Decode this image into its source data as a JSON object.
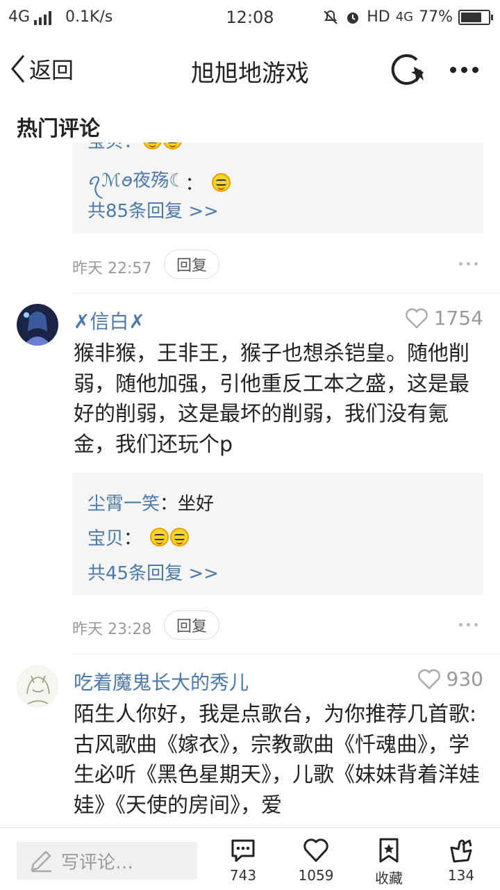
{
  "status_bar": {
    "network": "4G",
    "speed": "0.1K/s",
    "time": "12:08",
    "hd": "HD",
    "network_right": "4G",
    "battery": "77%"
  },
  "nav": {
    "back_label": "返回",
    "title": "旭旭地游戏"
  },
  "section_title": "热门评论",
  "comment0": {
    "replies_top_partial": "宝贝：",
    "reply_user": "ꪖℳꪮ夜殇☾",
    "reply_sep": "：",
    "more_replies": "共85条回复 >>",
    "time": "昨天 22:57",
    "reply_button": "回复"
  },
  "comment1": {
    "username": "✗信白✗",
    "likes": "1754",
    "text": "猴非猴，王非王，猴子也想杀铠皇。随他削弱，随他加强，引他重反工本之盛，这是最好的削弱，这是最坏的削弱，我们没有氪金，我们还玩个p",
    "replies": [
      {
        "user": "尘霄一笑",
        "sep": "：",
        "text": "坐好"
      },
      {
        "user": "宝贝",
        "sep": "：",
        "text": ""
      }
    ],
    "more_replies": "共45条回复 >>",
    "time": "昨天 23:28",
    "reply_button": "回复"
  },
  "comment2": {
    "username": "吃着魔鬼长大的秀儿",
    "likes": "930",
    "text": "陌生人你好，我是点歌台，为你推荐几首歌:古风歌曲《嫁衣》，宗教歌曲《忏魂曲》，学生必听《黑色星期天》，儿歌《妹妹背着洋娃娃》《天使的房间》，爱"
  },
  "bottom_bar": {
    "write_placeholder": "写评论…",
    "comments_count": "743",
    "likes_count": "1059",
    "favorite_label": "收藏",
    "share_count": "134"
  }
}
